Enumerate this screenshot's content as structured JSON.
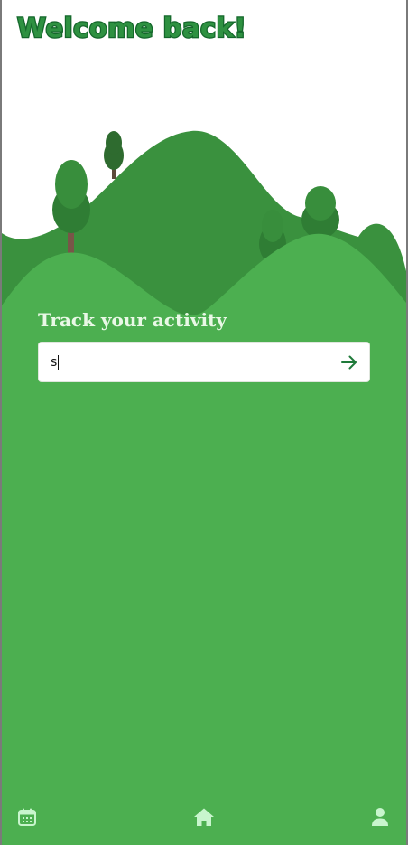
{
  "header": {
    "title": "Welcome back!"
  },
  "main": {
    "heading": "Track your activity",
    "activity_input": {
      "value": "s",
      "placeholder": ""
    },
    "submit_icon": "arrow-right-icon"
  },
  "bottom_nav": {
    "items": [
      {
        "icon": "calendar-icon"
      },
      {
        "icon": "home-icon"
      },
      {
        "icon": "user-icon"
      }
    ]
  },
  "colors": {
    "title_fill": "#2e9141",
    "title_stroke": "#16692d",
    "back_hill": "#3a913e",
    "front_hill": "#4caf50",
    "tree_dark": "#2f7d34",
    "tree_light": "#3a9641",
    "trunk": "#795548",
    "heading_text": "#e9f8e6",
    "arrow": "#1f7a3a",
    "nav_icon": "#c8f5cd"
  }
}
